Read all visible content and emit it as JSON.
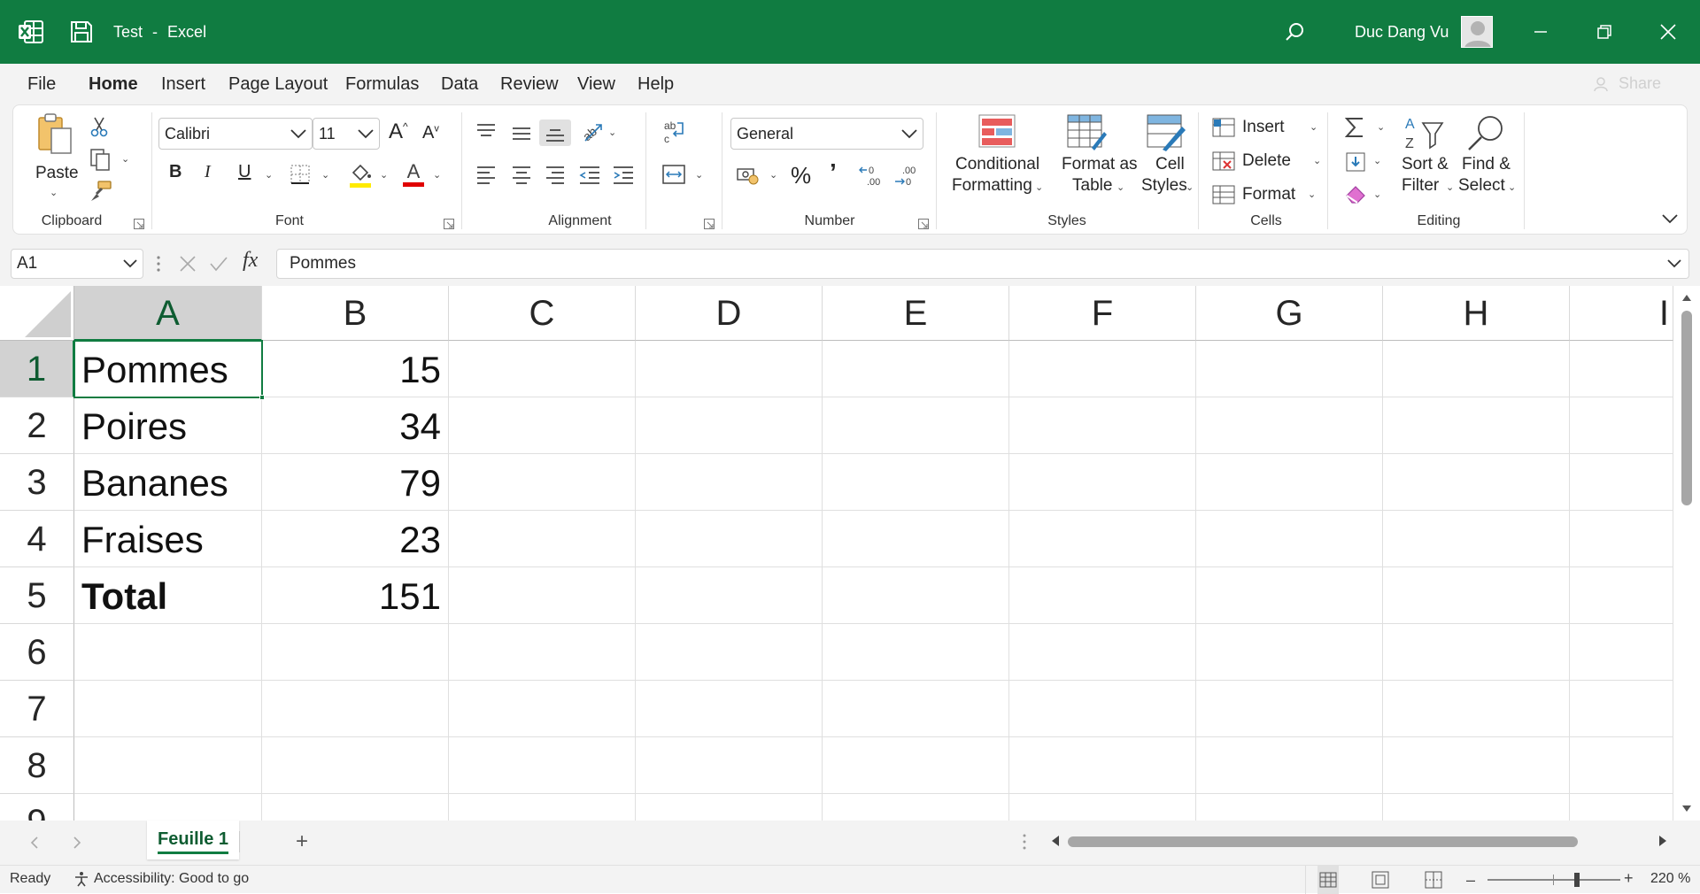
{
  "app": {
    "file_name": "Test",
    "separator": "-",
    "app_name": "Excel",
    "user_name": "Duc Dang Vu",
    "accent_color": "#107c41"
  },
  "menu": {
    "items": [
      "File",
      "Home",
      "Insert",
      "Page Layout",
      "Formulas",
      "Data",
      "Review",
      "View",
      "Help"
    ],
    "active": "Home",
    "share_label": "Share"
  },
  "ribbon": {
    "clipboard": {
      "paste_label": "Paste",
      "group_label": "Clipboard"
    },
    "font": {
      "font_name": "Calibri",
      "font_size": "11",
      "group_label": "Font",
      "bold": "B",
      "italic": "I",
      "underline": "U"
    },
    "alignment": {
      "group_label": "Alignment"
    },
    "number": {
      "format": "General",
      "group_label": "Number"
    },
    "styles": {
      "conditional_line1": "Conditional",
      "conditional_line2": "Formatting",
      "format_table_line1": "Format as",
      "format_table_line2": "Table",
      "cell_styles_line1": "Cell",
      "cell_styles_line2": "Styles",
      "group_label": "Styles"
    },
    "cells": {
      "insert": "Insert",
      "delete": "Delete",
      "format": "Format",
      "group_label": "Cells"
    },
    "editing": {
      "sort_line1": "Sort &",
      "sort_line2": "Filter",
      "find_line1": "Find &",
      "find_line2": "Select",
      "group_label": "Editing"
    }
  },
  "formula_bar": {
    "name_box": "A1",
    "formula": "Pommes",
    "fx": "fx"
  },
  "grid": {
    "columns": [
      "A",
      "B",
      "C",
      "D",
      "E",
      "F",
      "G",
      "H",
      "I"
    ],
    "rows": [
      "1",
      "2",
      "3",
      "4",
      "5",
      "6",
      "7",
      "8",
      "9"
    ],
    "selected_cell": "A1",
    "cells": [
      {
        "a": "Pommes",
        "b": "15"
      },
      {
        "a": "Poires",
        "b": "34"
      },
      {
        "a": "Bananes",
        "b": "79"
      },
      {
        "a": "Fraises",
        "b": "23"
      },
      {
        "a": "Total",
        "b": "151"
      }
    ]
  },
  "sheets": {
    "tabs": [
      "Feuille 1"
    ],
    "active": "Feuille 1",
    "add_label": "+"
  },
  "status": {
    "ready": "Ready",
    "accessibility": "Accessibility: Good to go",
    "zoom": "220 %"
  }
}
